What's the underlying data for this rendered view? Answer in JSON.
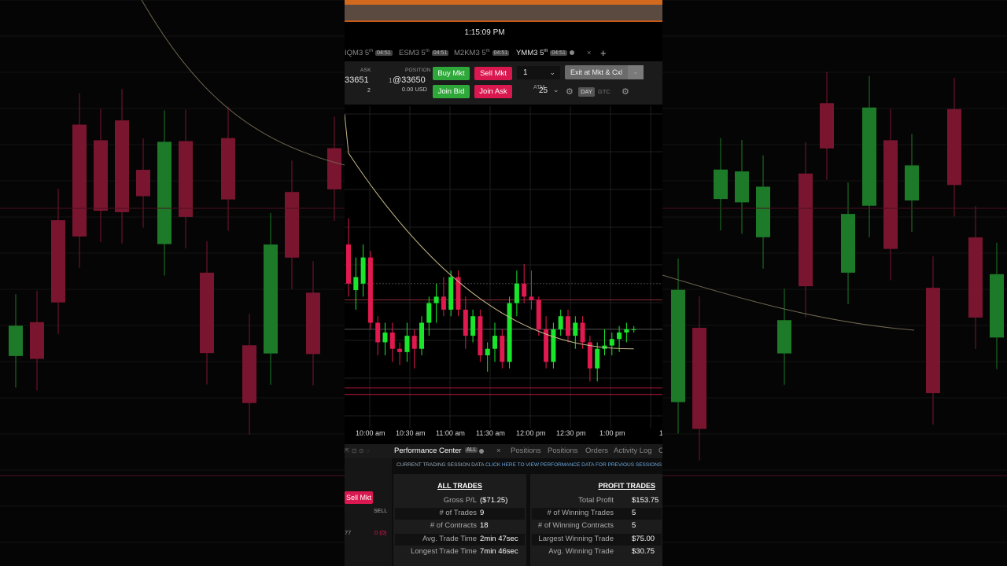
{
  "status_time": "1:15:09 PM",
  "tabs": [
    {
      "label": "IQM3 5",
      "sup": "m",
      "badge": "04:51"
    },
    {
      "label": "ESM3 5",
      "sup": "m",
      "badge": "04:51"
    },
    {
      "label": "M2KM3 5",
      "sup": "m",
      "badge": "04:51"
    },
    {
      "label": "YMM3 5",
      "sup": "m",
      "badge": "04:51",
      "active": true
    }
  ],
  "add_tab": "+",
  "close_tab": "×",
  "trade": {
    "ask_label": "ASK",
    "ask_value": "33651",
    "ask_size": "2",
    "position_label": "POSITION",
    "position_value": "@33650",
    "position_qty": "1",
    "position_usd": "0.00 USD",
    "buy_mkt": "Buy Mkt",
    "sell_mkt": "Sell Mkt",
    "join_bid": "Join Bid",
    "join_ask": "Join Ask",
    "quantity": "1",
    "exit_label": "Exit at Mkt & Cxl",
    "atm_label": "ATM",
    "atm_value": "25",
    "day": "DAY",
    "gtc": "GTC"
  },
  "x_axis": [
    "10:00 am",
    "10:30 am",
    "11:00 am",
    "11:30 am",
    "12:00 pm",
    "12:30 pm",
    "1:00 pm",
    "1"
  ],
  "chart_data": {
    "type": "candlestick",
    "series_colors": {
      "up": "#19e62b",
      "down": "#e0194f",
      "ma": "#c8b98a"
    },
    "candles": [
      {
        "o": 33672,
        "h": 33680,
        "l": 33656,
        "c": 33660
      },
      {
        "o": 33658,
        "h": 33668,
        "l": 33652,
        "c": 33662
      },
      {
        "o": 33660,
        "h": 33672,
        "l": 33656,
        "c": 33668
      },
      {
        "o": 33668,
        "h": 33670,
        "l": 33646,
        "c": 33648
      },
      {
        "o": 33648,
        "h": 33650,
        "l": 33638,
        "c": 33642
      },
      {
        "o": 33642,
        "h": 33648,
        "l": 33638,
        "c": 33645
      },
      {
        "o": 33645,
        "h": 33648,
        "l": 33636,
        "c": 33640
      },
      {
        "o": 33640,
        "h": 33642,
        "l": 33635,
        "c": 33639
      },
      {
        "o": 33639,
        "h": 33648,
        "l": 33636,
        "c": 33644
      },
      {
        "o": 33644,
        "h": 33646,
        "l": 33634,
        "c": 33640
      },
      {
        "o": 33640,
        "h": 33650,
        "l": 33638,
        "c": 33648
      },
      {
        "o": 33648,
        "h": 33656,
        "l": 33644,
        "c": 33654
      },
      {
        "o": 33654,
        "h": 33660,
        "l": 33648,
        "c": 33656
      },
      {
        "o": 33656,
        "h": 33662,
        "l": 33650,
        "c": 33652
      },
      {
        "o": 33652,
        "h": 33664,
        "l": 33650,
        "c": 33662
      },
      {
        "o": 33662,
        "h": 33664,
        "l": 33650,
        "c": 33652
      },
      {
        "o": 33652,
        "h": 33656,
        "l": 33640,
        "c": 33644
      },
      {
        "o": 33644,
        "h": 33652,
        "l": 33642,
        "c": 33650
      },
      {
        "o": 33650,
        "h": 33652,
        "l": 33636,
        "c": 33638
      },
      {
        "o": 33638,
        "h": 33642,
        "l": 33633,
        "c": 33640
      },
      {
        "o": 33640,
        "h": 33648,
        "l": 33636,
        "c": 33644
      },
      {
        "o": 33644,
        "h": 33646,
        "l": 33634,
        "c": 33636
      },
      {
        "o": 33636,
        "h": 33656,
        "l": 33634,
        "c": 33654
      },
      {
        "o": 33654,
        "h": 33664,
        "l": 33650,
        "c": 33660
      },
      {
        "o": 33660,
        "h": 33666,
        "l": 33654,
        "c": 33656
      },
      {
        "o": 33656,
        "h": 33664,
        "l": 33652,
        "c": 33655
      },
      {
        "o": 33655,
        "h": 33656,
        "l": 33644,
        "c": 33646
      },
      {
        "o": 33646,
        "h": 33650,
        "l": 33634,
        "c": 33636
      },
      {
        "o": 33636,
        "h": 33648,
        "l": 33634,
        "c": 33646
      },
      {
        "o": 33646,
        "h": 33652,
        "l": 33644,
        "c": 33650
      },
      {
        "o": 33650,
        "h": 33652,
        "l": 33642,
        "c": 33644
      },
      {
        "o": 33644,
        "h": 33650,
        "l": 33640,
        "c": 33648
      },
      {
        "o": 33648,
        "h": 33650,
        "l": 33640,
        "c": 33642
      },
      {
        "o": 33642,
        "h": 33644,
        "l": 33630,
        "c": 33634
      },
      {
        "o": 33634,
        "h": 33642,
        "l": 33630,
        "c": 33640
      },
      {
        "o": 33640,
        "h": 33646,
        "l": 33638,
        "c": 33641
      },
      {
        "o": 33641,
        "h": 33645,
        "l": 33638,
        "c": 33643
      },
      {
        "o": 33643,
        "h": 33647,
        "l": 33639,
        "c": 33645
      },
      {
        "o": 33645,
        "h": 33648,
        "l": 33642,
        "c": 33646
      },
      {
        "o": 33646,
        "h": 33647,
        "l": 33645,
        "c": 33646
      }
    ]
  },
  "perf": {
    "icons_left": "⇱ ⊡ ⊙ ◌",
    "title": "Performance Center",
    "all_badge": "ALL",
    "tabs": [
      "Positions",
      "Positions",
      "Orders",
      "Activity Log",
      "C"
    ],
    "info_static": "CURRENT TRADING SESSION DATA",
    "info_link": "CLICK HERE TO VIEW PERFORMANCE DATA FOR PREVIOUS SESSIONS",
    "all_trades": {
      "title": "ALL TRADES",
      "rows": [
        {
          "k": "Gross P/L",
          "v": "($71.25)"
        },
        {
          "k": "# of Trades",
          "v": "9"
        },
        {
          "k": "# of Contracts",
          "v": "18"
        },
        {
          "k": "Avg. Trade Time",
          "v": "2min 47sec"
        },
        {
          "k": "Longest Trade Time",
          "v": "7min 46sec"
        }
      ]
    },
    "profit_trades": {
      "title": "PROFIT TRADES",
      "rows": [
        {
          "k": "Total Profit",
          "v": "$153.75"
        },
        {
          "k": "# of Winning Trades",
          "v": "5"
        },
        {
          "k": "# of Winning Contracts",
          "v": "5"
        },
        {
          "k": "Largest Winning Trade",
          "v": "$75.00"
        },
        {
          "k": "Avg. Winning Trade",
          "v": "$30.75"
        }
      ]
    }
  },
  "left_panel": {
    "sell_mkt": "Sell Mkt",
    "sell_label": "SELL",
    "row_left": "77",
    "row_right": "0 (0)"
  }
}
